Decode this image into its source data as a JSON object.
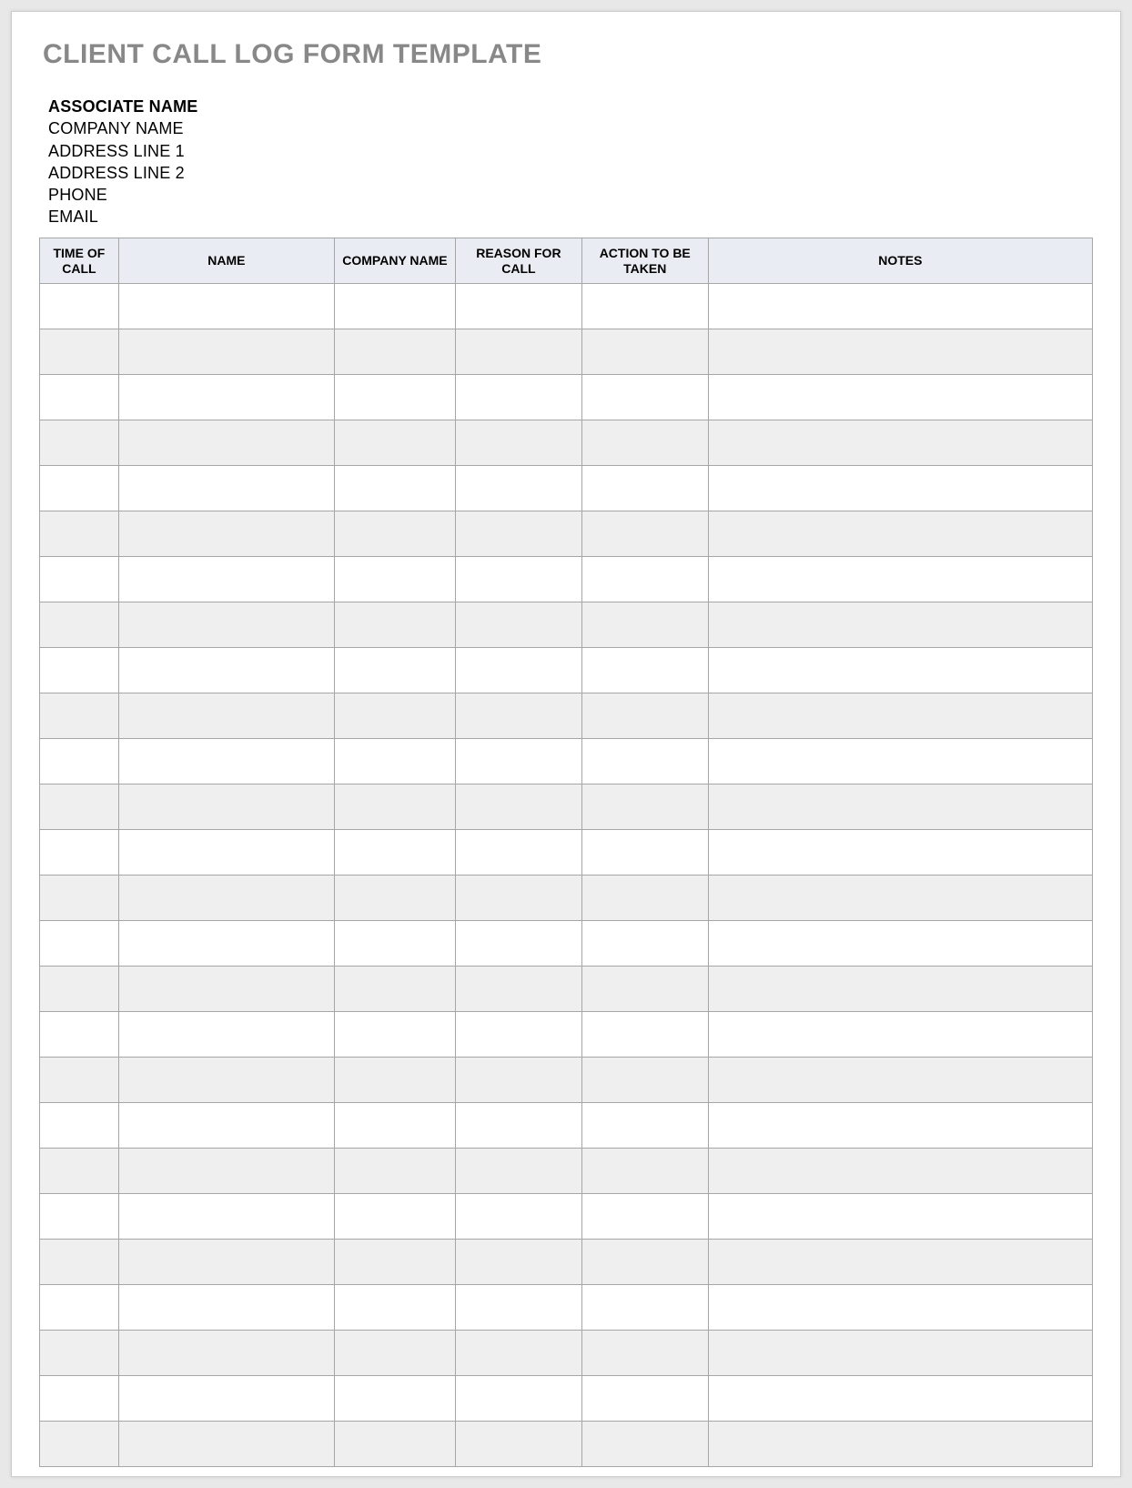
{
  "title": "CLIENT CALL LOG FORM TEMPLATE",
  "info": {
    "associate_name": "ASSOCIATE NAME",
    "company_name": "COMPANY NAME",
    "address_line_1": "ADDRESS LINE 1",
    "address_line_2": "ADDRESS LINE 2",
    "phone": "PHONE",
    "email": "EMAIL"
  },
  "table": {
    "headers": {
      "time_of_call": "TIME OF CALL",
      "name": "NAME",
      "company_name": "COMPANY NAME",
      "reason_for_call": "REASON FOR CALL",
      "action_to_be_taken": "ACTION TO BE TAKEN",
      "notes": "NOTES"
    },
    "row_count": 26
  }
}
